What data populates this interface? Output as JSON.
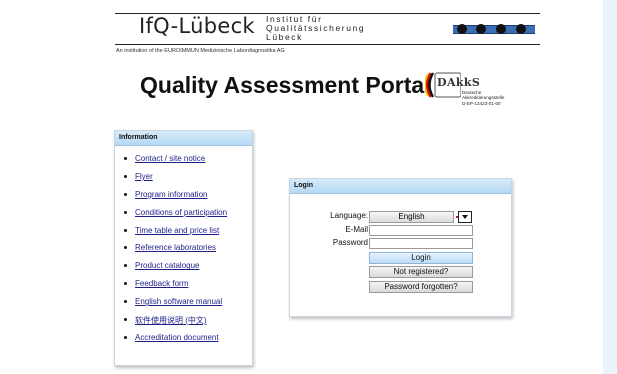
{
  "header": {
    "logo_main": "IfQ-Lübeck",
    "logo_sub_line1": "Institut für",
    "logo_sub_line2": "Qualitätssicherung",
    "logo_sub_line3": "Lübeck",
    "institution": "An institution of the EUROIMMUN Medizinische Labordiagnostika AG"
  },
  "title": "Quality Assessment Portal",
  "dakks": {
    "name": "DAkkS",
    "line1": "Deutsche",
    "line2": "Akkreditierungsstelle",
    "line3": "D-EP-13423-01-00"
  },
  "info": {
    "title": "Information",
    "links": [
      "Contact / site notice",
      "Flyer",
      "Program information",
      "Conditions of participation",
      "Time table and price list",
      "Reference laboratories",
      "Product catalogue",
      "Feedback form",
      "English software manual",
      "软件使用说明 (中文)",
      "Accreditation document"
    ]
  },
  "login": {
    "title": "Login",
    "language_label": "Language:",
    "language_value": "English",
    "email_label": "E-Mail",
    "email_value": "",
    "password_label": "Password",
    "password_value": "",
    "login_button": "Login",
    "register_button": "Not registered?",
    "forgot_button": "Password forgotten?"
  },
  "colors": {
    "panel_header": "#c6e2f7",
    "link": "#1f1f8a",
    "bar": "#3b6fb5"
  }
}
